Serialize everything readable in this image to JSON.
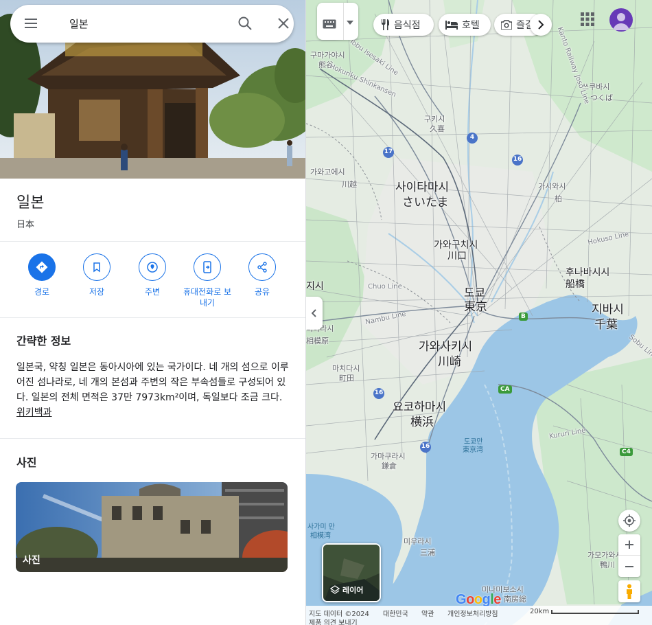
{
  "search": {
    "query": "일본"
  },
  "place": {
    "title": "일본",
    "subtitle": "日本"
  },
  "actions": [
    {
      "label": "경로",
      "icon": "directions-icon"
    },
    {
      "label": "저장",
      "icon": "bookmark-icon"
    },
    {
      "label": "주변",
      "icon": "nearby-icon"
    },
    {
      "label": "휴대전화로 보내기",
      "icon": "send-to-phone-icon"
    },
    {
      "label": "공유",
      "icon": "share-icon"
    }
  ],
  "brief": {
    "title": "간략한 정보",
    "text": "일본국, 약칭 일본은 동아시아에 있는 국가이다. 네 개의 섬으로 이루어진 섬나라로, 네 개의 본섬과 주변의 작은 부속섬들로 구성되어 있다. 일본의 전체 면적은 37만 7973km²이며, 독일보다 조금 크다. ",
    "link": "위키백과"
  },
  "photos": {
    "title": "사진",
    "card_label": "사진"
  },
  "map": {
    "chips": [
      "음식점",
      "호텔",
      "즐길"
    ],
    "layers_label": "레이어",
    "google_logo": "Google",
    "footer": {
      "data": "지도 데이터 ©2024",
      "country": "대한민국",
      "terms": "약관",
      "privacy": "개인정보처리방침",
      "feedback": "제품 의견 보내기",
      "scale": "20km"
    },
    "labels": {
      "saitama_ko": "사이타마시",
      "saitama_jp": "さいたま",
      "kawaguchi_ko": "가와구치시",
      "kawaguchi_jp": "川口",
      "tokyo_ko": "도쿄",
      "tokyo_jp": "東京",
      "kawasaki_ko": "가와사키시",
      "kawasaki_jp": "川崎",
      "yokohama_ko": "요코하마시",
      "yokohama_jp": "横浜",
      "chiba_ko": "지바시",
      "chiba_jp": "千葉",
      "funabashi_ko": "후나바시시",
      "funabashi_jp": "船橋",
      "kashiwa_ko": "가시와시",
      "kashiwa_jp": "柏",
      "kawagoe_ko": "가와고에시",
      "kawagoe_jp": "川越",
      "sagamihara_ko": "미하라시",
      "sagamihara_jp": "相模原",
      "machida_ko": "마치다시",
      "machida_jp": "町田",
      "kamakura_ko": "가마쿠라시",
      "kamakura_jp": "鎌倉",
      "miura_ko": "미우라시",
      "miura_jp": "三浦",
      "kuki_ko": "구키시",
      "kuki_jp": "久喜",
      "tsukuba_ko": "쓰쿠바시",
      "tsukuba_jp": "つくば",
      "kamagaya_ko": "구마가야시",
      "kamagaya_jp": "熊谷",
      "kisarazu_ko": "가모가와시",
      "kisarazu_jp": "鴨川",
      "minamiboso_ko": "미나미보소시",
      "minamiboso_jp": "南房総",
      "tokyo_bay_ko": "도쿄만",
      "tokyo_bay_jp": "東京湾",
      "sagami_bay_ko": "사가미 만",
      "sagami_bay_jp": "相模湾",
      "hachioji": "지시",
      "hokuriku": "Hokuriku Shinkansen",
      "chuo": "Chuo Line",
      "nambu": "Nambu Line",
      "hokuso": "Hokuso Line",
      "kururi": "Kururi Line",
      "sobu": "Sobu Line",
      "kanto": "Kanto Railway Joso Line",
      "ryomo": "Tobu Isesaki Line"
    },
    "routes": [
      "17",
      "4",
      "16",
      "16",
      "16",
      "B",
      "CA",
      "C4"
    ]
  }
}
